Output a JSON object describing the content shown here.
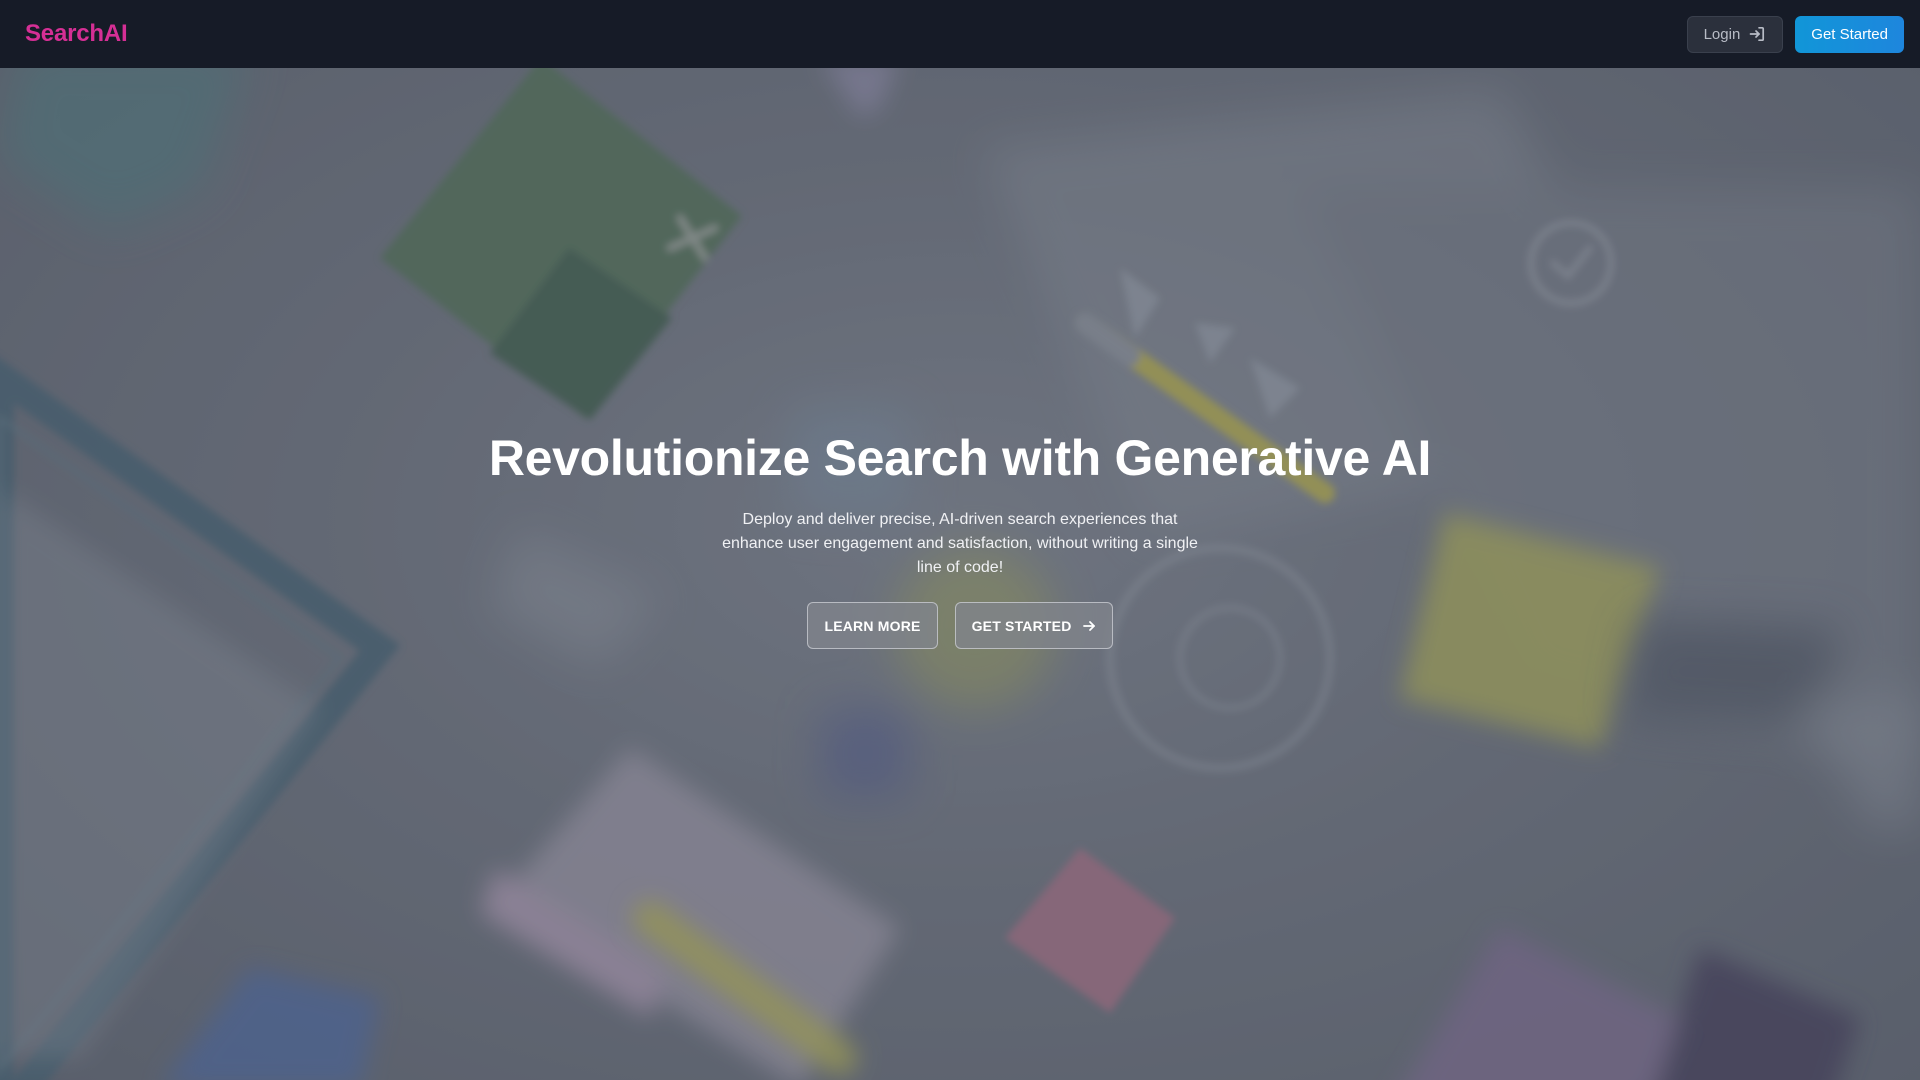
{
  "header": {
    "brand": "SearchAI",
    "login_label": "Login",
    "login_icon": "sign-in-icon",
    "get_started_label": "Get Started"
  },
  "hero": {
    "title": "Revolutionize Search with Generative AI",
    "subtitle": "Deploy and deliver precise, AI-driven search experiences that enhance user engagement and satisfaction, without writing a single line of code!",
    "learn_more_label": "LEARN MORE",
    "get_started_label": "GET STARTED",
    "get_started_icon": "arrow-right-icon"
  },
  "colors": {
    "brand": "#d52f95",
    "header_bg": "#161b27",
    "cta_bg": "#1196d8"
  }
}
